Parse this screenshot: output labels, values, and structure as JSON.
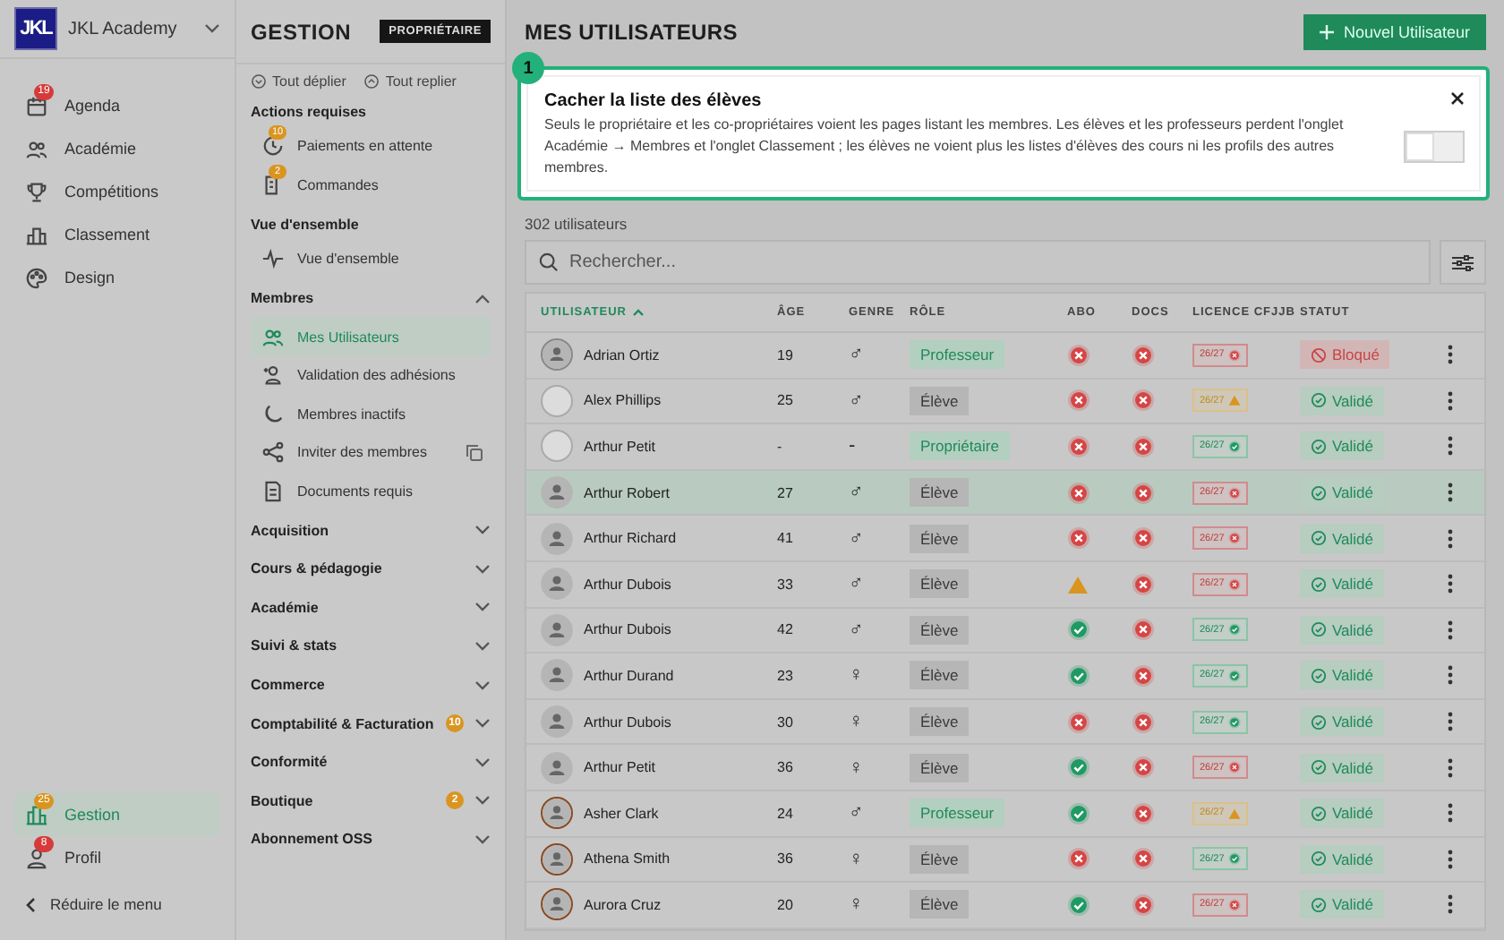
{
  "sidebar": {
    "logo": "JKL",
    "org_name": "JKL Academy",
    "items": [
      {
        "label": "Agenda",
        "badge": {
          "text": "19",
          "color": "#d63a3a"
        },
        "selected": false
      },
      {
        "label": "Académie",
        "selected": false
      },
      {
        "label": "Compétitions",
        "selected": false
      },
      {
        "label": "Classement",
        "selected": false
      },
      {
        "label": "Design",
        "selected": false
      }
    ],
    "bottom_items": [
      {
        "label": "Gestion",
        "badge": {
          "text": "25",
          "color": "#d9951f"
        },
        "selected": true
      },
      {
        "label": "Profil",
        "badge": {
          "text": "8",
          "color": "#d63a3a"
        },
        "selected": false
      }
    ],
    "collapse": "Réduire le menu"
  },
  "panel": {
    "title": "GESTION",
    "role_badge": "PROPRIÉTAIRE",
    "expand_all": "Tout déplier",
    "collapse_all": "Tout replier",
    "sections": [
      {
        "label": "Actions requises",
        "kind": "static",
        "items": [
          {
            "label": "Paiements en attente",
            "badge": "10",
            "selected": false
          },
          {
            "label": "Commandes",
            "badge": "2",
            "selected": false
          }
        ]
      },
      {
        "label": "Vue d'ensemble",
        "kind": "static",
        "items": [
          {
            "label": "Vue d'ensemble",
            "selected": false
          }
        ]
      },
      {
        "label": "Membres",
        "kind": "group",
        "expanded": true,
        "items": [
          {
            "label": "Mes Utilisateurs",
            "selected": true
          },
          {
            "label": "Validation des adhésions",
            "selected": false
          },
          {
            "label": "Membres inactifs",
            "selected": false
          },
          {
            "label": "Inviter des membres",
            "selected": false
          },
          {
            "label": "Documents requis",
            "selected": false
          }
        ]
      },
      {
        "label": "Acquisition",
        "kind": "group",
        "expanded": false
      },
      {
        "label": "Cours & pédagogie",
        "kind": "group",
        "expanded": false
      },
      {
        "label": "Académie",
        "kind": "group",
        "expanded": false
      },
      {
        "label": "Suivi & stats",
        "kind": "group",
        "expanded": false
      },
      {
        "label": "Commerce",
        "kind": "group",
        "expanded": false
      },
      {
        "label": "Comptabilité & Facturation",
        "kind": "group",
        "expanded": false,
        "badge": "10"
      },
      {
        "label": "Conformité",
        "kind": "group",
        "expanded": false
      },
      {
        "label": "Boutique",
        "kind": "group",
        "expanded": false,
        "badge": "2"
      },
      {
        "label": "Abonnement OSS",
        "kind": "group",
        "expanded": false
      }
    ]
  },
  "main": {
    "title": "MES UTILISATEURS",
    "new_button": "Nouvel Utilisateur",
    "callout": {
      "step": "1",
      "title": "Cacher la liste des élèves",
      "text": "Seuls le propriétaire et les co-propriétaires voient les pages listant les membres. Les élèves et les professeurs perdent l'onglet Académie → Membres et l'onglet Classement ; les élèves ne voient plus les listes d'élèves des cours ni les profils des autres membres.",
      "on": false
    },
    "count": "302 utilisateurs",
    "search": {
      "placeholder": "Rechercher..."
    },
    "table": {
      "columns": [
        {
          "label": "UTILISATEUR",
          "sorted": true
        },
        {
          "label": "ÂGE",
          "sorted": false
        },
        {
          "label": "GENRE",
          "sorted": false
        },
        {
          "label": "RÔLE",
          "sorted": false
        },
        {
          "label": "ABO",
          "sorted": false
        },
        {
          "label": "DOCS",
          "sorted": false
        },
        {
          "label": "LICENCE CFJJB",
          "sorted": false
        },
        {
          "label": "STATUT",
          "sorted": false
        }
      ],
      "rows": [
        {
          "avatar": {
            "kind": "outlined"
          },
          "name": "Adrian Ortiz",
          "age": "19",
          "gender": "♂",
          "role": {
            "text": "Professeur",
            "kind": "teacher"
          },
          "abo": {
            "kind": "error"
          },
          "docs": {
            "kind": "error"
          },
          "licence": {
            "text": "26/27",
            "kind": "error"
          },
          "status": {
            "text": "Bloqué",
            "kind": "blocked"
          },
          "selected": false
        },
        {
          "avatar": {
            "kind": "thumbnail"
          },
          "name": "Alex Phillips",
          "age": "25",
          "gender": "♂",
          "role": {
            "text": "Élève",
            "kind": "student"
          },
          "abo": {
            "kind": "error"
          },
          "docs": {
            "kind": "error"
          },
          "licence": {
            "text": "26/27",
            "kind": "warning"
          },
          "status": {
            "text": "Validé",
            "kind": "valid"
          },
          "selected": false
        },
        {
          "avatar": {
            "kind": "thumbnail"
          },
          "name": "Arthur Petit",
          "age": "-",
          "gender": "-",
          "role": {
            "text": "Propriétaire",
            "kind": "owner"
          },
          "abo": {
            "kind": "error"
          },
          "docs": {
            "kind": "error"
          },
          "licence": {
            "text": "26/27",
            "kind": "ok"
          },
          "status": {
            "text": "Validé",
            "kind": "valid"
          },
          "selected": false
        },
        {
          "avatar": {
            "kind": "default"
          },
          "name": "Arthur Robert",
          "age": "27",
          "gender": "♂",
          "role": {
            "text": "Élève",
            "kind": "student"
          },
          "abo": {
            "kind": "error"
          },
          "docs": {
            "kind": "error"
          },
          "licence": {
            "text": "26/27",
            "kind": "error"
          },
          "status": {
            "text": "Validé",
            "kind": "valid"
          },
          "selected": true
        },
        {
          "avatar": {
            "kind": "default"
          },
          "name": "Arthur Richard",
          "age": "41",
          "gender": "♂",
          "role": {
            "text": "Élève",
            "kind": "student"
          },
          "abo": {
            "kind": "error"
          },
          "docs": {
            "kind": "error"
          },
          "licence": {
            "text": "26/27",
            "kind": "error"
          },
          "status": {
            "text": "Validé",
            "kind": "valid"
          },
          "selected": false
        },
        {
          "avatar": {
            "kind": "default"
          },
          "name": "Arthur Dubois",
          "age": "33",
          "gender": "♂",
          "role": {
            "text": "Élève",
            "kind": "student"
          },
          "abo": {
            "kind": "warning"
          },
          "docs": {
            "kind": "error"
          },
          "licence": {
            "text": "26/27",
            "kind": "error"
          },
          "status": {
            "text": "Validé",
            "kind": "valid"
          },
          "selected": false
        },
        {
          "avatar": {
            "kind": "default"
          },
          "name": "Arthur Dubois",
          "age": "42",
          "gender": "♂",
          "role": {
            "text": "Élève",
            "kind": "student"
          },
          "abo": {
            "kind": "ok"
          },
          "docs": {
            "kind": "error"
          },
          "licence": {
            "text": "26/27",
            "kind": "ok"
          },
          "status": {
            "text": "Validé",
            "kind": "valid"
          },
          "selected": false
        },
        {
          "avatar": {
            "kind": "default"
          },
          "name": "Arthur Durand",
          "age": "23",
          "gender": "♀",
          "role": {
            "text": "Élève",
            "kind": "student"
          },
          "abo": {
            "kind": "ok"
          },
          "docs": {
            "kind": "error"
          },
          "licence": {
            "text": "26/27",
            "kind": "ok"
          },
          "status": {
            "text": "Validé",
            "kind": "valid"
          },
          "selected": false
        },
        {
          "avatar": {
            "kind": "default"
          },
          "name": "Arthur Dubois",
          "age": "30",
          "gender": "♀",
          "role": {
            "text": "Élève",
            "kind": "student"
          },
          "abo": {
            "kind": "error"
          },
          "docs": {
            "kind": "error"
          },
          "licence": {
            "text": "26/27",
            "kind": "ok"
          },
          "status": {
            "text": "Validé",
            "kind": "valid"
          },
          "selected": false
        },
        {
          "avatar": {
            "kind": "default"
          },
          "name": "Arthur Petit",
          "age": "36",
          "gender": "♀",
          "role": {
            "text": "Élève",
            "kind": "student"
          },
          "abo": {
            "kind": "ok"
          },
          "docs": {
            "kind": "error"
          },
          "licence": {
            "text": "26/27",
            "kind": "error"
          },
          "status": {
            "text": "Validé",
            "kind": "valid"
          },
          "selected": false
        },
        {
          "avatar": {
            "kind": "ringed"
          },
          "name": "Asher Clark",
          "age": "24",
          "gender": "♂",
          "role": {
            "text": "Professeur",
            "kind": "teacher"
          },
          "abo": {
            "kind": "ok"
          },
          "docs": {
            "kind": "error"
          },
          "licence": {
            "text": "26/27",
            "kind": "warning"
          },
          "status": {
            "text": "Validé",
            "kind": "valid"
          },
          "selected": false
        },
        {
          "avatar": {
            "kind": "ringed"
          },
          "name": "Athena Smith",
          "age": "36",
          "gender": "♀",
          "role": {
            "text": "Élève",
            "kind": "student"
          },
          "abo": {
            "kind": "error"
          },
          "docs": {
            "kind": "error"
          },
          "licence": {
            "text": "26/27",
            "kind": "ok"
          },
          "status": {
            "text": "Validé",
            "kind": "valid"
          },
          "selected": false
        },
        {
          "avatar": {
            "kind": "ringed"
          },
          "name": "Aurora Cruz",
          "age": "20",
          "gender": "♀",
          "role": {
            "text": "Élève",
            "kind": "student"
          },
          "abo": {
            "kind": "ok"
          },
          "docs": {
            "kind": "error"
          },
          "licence": {
            "text": "26/27",
            "kind": "error"
          },
          "status": {
            "text": "Validé",
            "kind": "valid"
          },
          "selected": false
        }
      ]
    }
  }
}
